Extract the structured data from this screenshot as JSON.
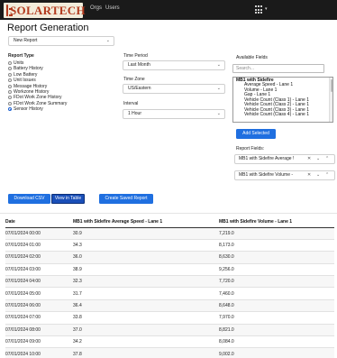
{
  "app": {
    "brand": "SOLARTECH",
    "nav": [
      "Orgs",
      "Users"
    ]
  },
  "page": {
    "title": "Report Generation"
  },
  "report_select": {
    "value": "New Report"
  },
  "report_type": {
    "label": "Report Type",
    "options": [
      {
        "label": "Units",
        "selected": false
      },
      {
        "label": "Battery History",
        "selected": false
      },
      {
        "label": "Low Battery",
        "selected": false
      },
      {
        "label": "Unit Issues",
        "selected": false
      },
      {
        "label": "Message History",
        "selected": false
      },
      {
        "label": "Workzone History",
        "selected": false
      },
      {
        "label": "FDot Work Zone History",
        "selected": false
      },
      {
        "label": "FDot Work Zone Summary",
        "selected": false
      },
      {
        "label": "Sensor History",
        "selected": true
      }
    ]
  },
  "time_period": {
    "label": "Time Period",
    "value": "Last Month"
  },
  "time_zone": {
    "label": "Time Zone",
    "value": "US/Eastern"
  },
  "interval": {
    "label": "Interval",
    "value": "1 Hour"
  },
  "available_fields": {
    "label": "Available Fields",
    "search_placeholder": "Search...",
    "group": "MB1 with Sidefire",
    "options": [
      "Average Speed - Lane 1",
      "Volume - Lane 1",
      "Gap - Lane 1",
      "Vehicle Count (Class 1) - Lane 1",
      "Vehicle Count (Class 2) - Lane 1",
      "Vehicle Count (Class 3) - Lane 1",
      "Vehicle Count (Class 4) - Lane 1"
    ]
  },
  "add_selected": "Add Selected",
  "report_fields": {
    "label": "Report Fields:",
    "items": [
      "MB1 with Sidefire Average !",
      "MB1 with Sidefire Volume -"
    ]
  },
  "actions": {
    "download_csv": "Download CSV",
    "view_in_table": "View in Table",
    "create_saved": "Create Saved Report"
  },
  "table": {
    "columns": [
      "Date",
      "MB1 with Sidefire Average Speed - Lane 1",
      "MB1 with Sidefire Volume - Lane 1"
    ],
    "rows": [
      [
        "07/01/2024 00:00",
        "30.9",
        "7,219.0"
      ],
      [
        "07/01/2024 01:00",
        "34.3",
        "8,173.0"
      ],
      [
        "07/01/2024 02:00",
        "36.0",
        "8,630.0"
      ],
      [
        "07/01/2024 03:00",
        "38.9",
        "9,256.0"
      ],
      [
        "07/01/2024 04:00",
        "32.3",
        "7,720.0"
      ],
      [
        "07/01/2024 05:00",
        "31.7",
        "7,460.0"
      ],
      [
        "07/01/2024 06:00",
        "36.4",
        "8,648.0"
      ],
      [
        "07/01/2024 07:00",
        "33.8",
        "7,970.0"
      ],
      [
        "07/01/2024 08:00",
        "37.0",
        "8,821.0"
      ],
      [
        "07/01/2024 09:00",
        "34.2",
        "8,084.0"
      ],
      [
        "07/01/2024 10:00",
        "37.8",
        "9,002.0"
      ]
    ]
  }
}
